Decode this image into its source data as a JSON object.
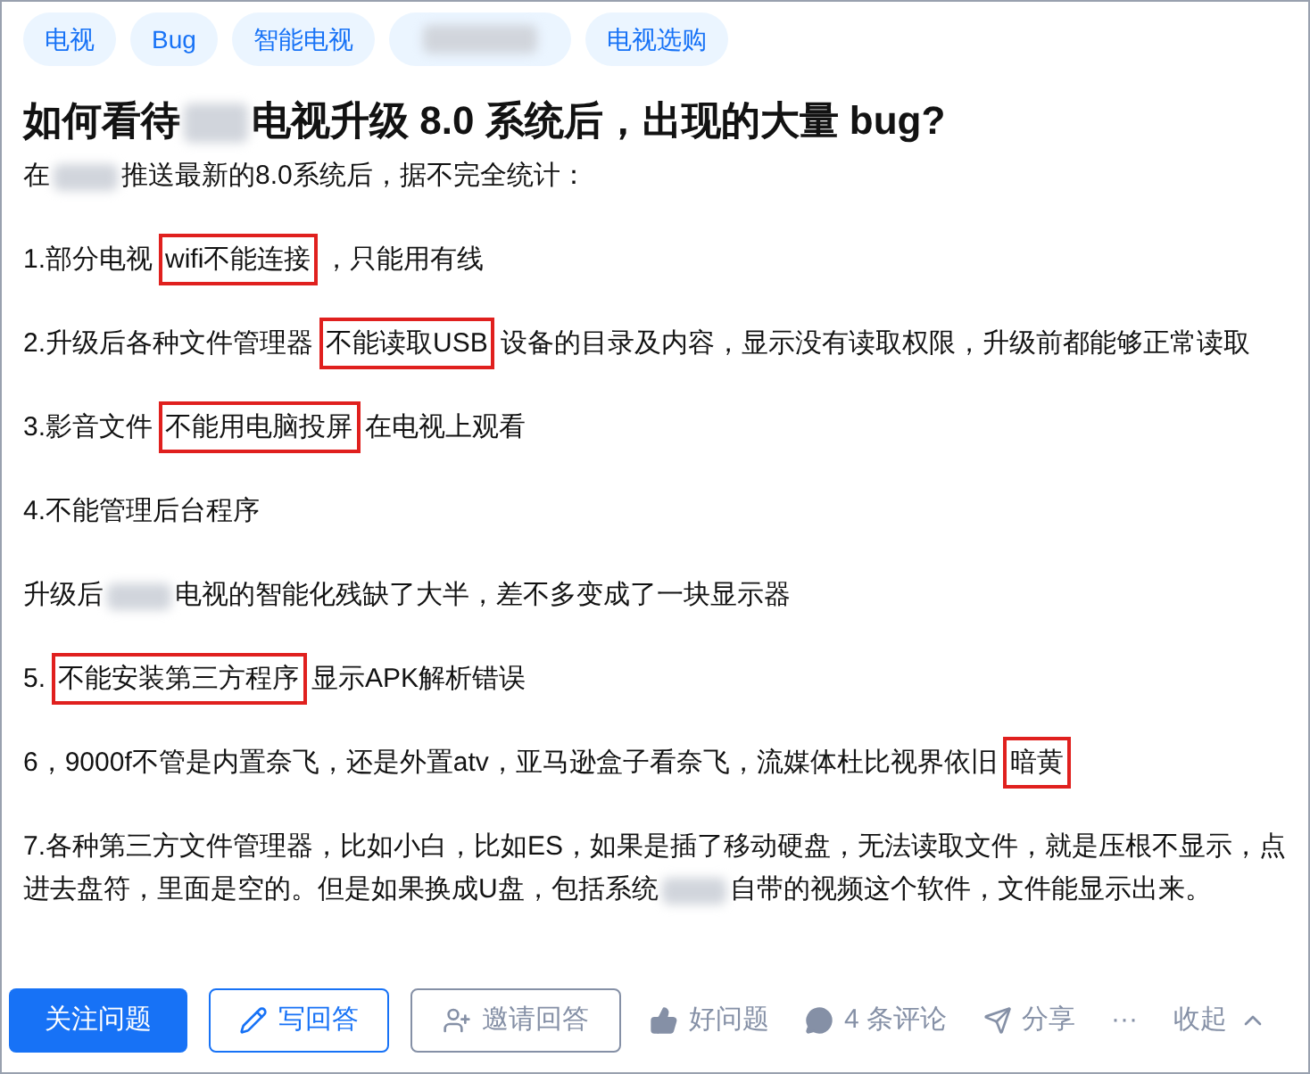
{
  "tags": [
    {
      "kind": "text",
      "label": "电视"
    },
    {
      "kind": "text",
      "label": "Bug"
    },
    {
      "kind": "text",
      "label": "智能电视"
    },
    {
      "kind": "blur"
    },
    {
      "kind": "text",
      "label": "电视选购"
    }
  ],
  "title": [
    {
      "kind": "text",
      "text": "如何看待"
    },
    {
      "kind": "blur"
    },
    {
      "kind": "text",
      "text": "电视升级 8.0 系统后，出现的大量 bug?"
    }
  ],
  "intro": [
    {
      "kind": "text",
      "text": "在"
    },
    {
      "kind": "blur"
    },
    {
      "kind": "text",
      "text": "推送最新的8.0系统后，据不完全统计："
    }
  ],
  "paragraphs": [
    [
      {
        "kind": "text",
        "text": "1.部分电视"
      },
      {
        "kind": "boxed",
        "text": "wifi不能连接"
      },
      {
        "kind": "text",
        "text": "，只能用有线"
      }
    ],
    [
      {
        "kind": "text",
        "text": "2.升级后各种文件管理器"
      },
      {
        "kind": "boxed",
        "text": "不能读取USB"
      },
      {
        "kind": "text",
        "text": "设备的目录及内容，显示没有读取权限，升级前都能够正常读取"
      }
    ],
    [
      {
        "kind": "text",
        "text": "3.影音文件"
      },
      {
        "kind": "boxed",
        "text": "不能用电脑投屏"
      },
      {
        "kind": "text",
        "text": "在电视上观看"
      }
    ],
    [
      {
        "kind": "text",
        "text": "4.不能管理后台程序"
      }
    ],
    [
      {
        "kind": "text",
        "text": "升级后"
      },
      {
        "kind": "blur"
      },
      {
        "kind": "text",
        "text": "电视的智能化残缺了大半，差不多变成了一块显示器"
      }
    ],
    [
      {
        "kind": "text",
        "text": "5."
      },
      {
        "kind": "boxed",
        "text": "不能安装第三方程序"
      },
      {
        "kind": "text",
        "text": "显示APK解析错误"
      }
    ],
    [
      {
        "kind": "text",
        "text": "6，9000f不管是内置奈飞，还是外置atv，亚马逊盒子看奈飞，流媒体杜比视界依旧"
      },
      {
        "kind": "boxed",
        "text": "暗黄"
      }
    ],
    [
      {
        "kind": "text",
        "text": "7.各种第三方文件管理器，比如小白，比如ES，如果是插了移动硬盘，无法读取文件，就是压根不显示，点进去盘符，里面是空的。但是如果换成U盘，包括系统"
      },
      {
        "kind": "blur"
      },
      {
        "kind": "text",
        "text": "自带的视频这个软件，文件能显示出来。"
      }
    ]
  ],
  "actions": [
    {
      "kind": "primary",
      "label": "关注问题"
    },
    {
      "kind": "outline",
      "label": "写回答"
    },
    {
      "kind": "outline-gray",
      "label": "邀请回答"
    },
    {
      "kind": "plain",
      "label": "好问题"
    },
    {
      "kind": "plain",
      "label": "4 条评论"
    },
    {
      "kind": "plain",
      "label": "分享"
    },
    {
      "kind": "more",
      "label": "···"
    },
    {
      "kind": "plain",
      "label": "收起"
    }
  ]
}
